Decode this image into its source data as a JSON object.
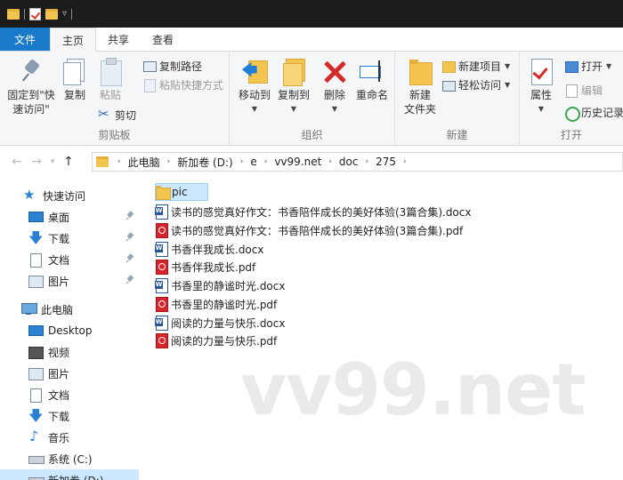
{
  "ribbon_tabs": [
    "文件",
    "主页",
    "共享",
    "查看"
  ],
  "clipboard": {
    "pin_label_1": "固定到\"快",
    "pin_label_2": "速访问\"",
    "copy": "复制",
    "paste": "粘贴",
    "copy_path": "复制路径",
    "paste_shortcut": "粘贴快捷方式",
    "cut": "剪切",
    "group": "剪贴板"
  },
  "organize": {
    "move_to": "移动到",
    "copy_to": "复制到",
    "delete": "删除",
    "rename": "重命名",
    "group": "组织"
  },
  "new": {
    "new_folder_1": "新建",
    "new_folder_2": "文件夹",
    "new_item": "新建项目",
    "easy_access": "轻松访问",
    "group": "新建"
  },
  "open": {
    "properties": "属性",
    "open": "打开",
    "edit": "编辑",
    "history": "历史记录",
    "group": "打开"
  },
  "breadcrumb": [
    "此电脑",
    "新加卷 (D:)",
    "e",
    "vv99.net",
    "doc",
    "275"
  ],
  "nav_pane": [
    {
      "label": "快速访问",
      "icon": "star-icon"
    },
    {
      "label": "桌面",
      "icon": "desktop-icon",
      "pinned": true
    },
    {
      "label": "下载",
      "icon": "download-icon",
      "pinned": true
    },
    {
      "label": "文档",
      "icon": "documents-icon",
      "pinned": true
    },
    {
      "label": "图片",
      "icon": "pictures-icon",
      "pinned": true
    },
    {
      "label": "此电脑",
      "icon": "computer-icon"
    },
    {
      "label": "Desktop",
      "icon": "desktop-icon"
    },
    {
      "label": "视频",
      "icon": "video-icon"
    },
    {
      "label": "图片",
      "icon": "pictures-icon"
    },
    {
      "label": "文档",
      "icon": "documents-icon"
    },
    {
      "label": "下载",
      "icon": "download-icon"
    },
    {
      "label": "音乐",
      "icon": "music-icon"
    },
    {
      "label": "系统 (C:)",
      "icon": "drive-icon"
    },
    {
      "label": "新加卷 (D:)",
      "icon": "drive-icon",
      "selected": true
    }
  ],
  "files": [
    {
      "name": "pic",
      "type": "folder",
      "selected": true
    },
    {
      "name": "读书的感觉真好作文：书香陪伴成长的美好体验(3篇合集).docx",
      "type": "docx"
    },
    {
      "name": "读书的感觉真好作文：书香陪伴成长的美好体验(3篇合集).pdf",
      "type": "pdf"
    },
    {
      "name": "书香伴我成长.docx",
      "type": "docx"
    },
    {
      "name": "书香伴我成长.pdf",
      "type": "pdf"
    },
    {
      "name": "书香里的静谧时光.docx",
      "type": "docx"
    },
    {
      "name": "书香里的静谧时光.pdf",
      "type": "pdf"
    },
    {
      "name": "阅读的力量与快乐.docx",
      "type": "docx"
    },
    {
      "name": "阅读的力量与快乐.pdf",
      "type": "pdf"
    }
  ],
  "watermark": "vv99.net",
  "colors": {
    "accent": "#1979ca",
    "selection": "#cce8ff",
    "folder": "#f3c44e",
    "pdf": "#d8232a",
    "word": "#2b5797"
  }
}
